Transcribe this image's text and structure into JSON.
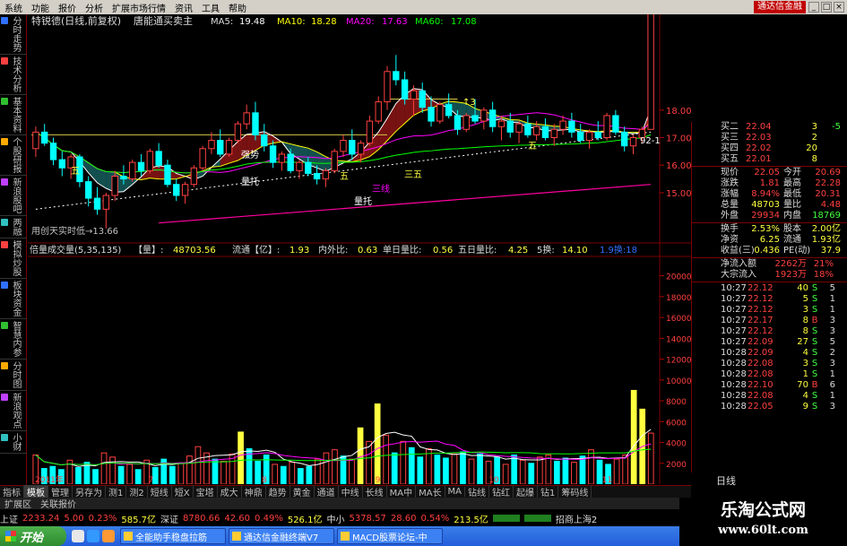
{
  "menubar": {
    "items": [
      "系统",
      "功能",
      "报价",
      "分析",
      "扩展市场行情",
      "资讯",
      "工具",
      "帮助"
    ],
    "brand": "通达信金融"
  },
  "left_tabs": [
    "分时走势",
    "技术分析",
    "基本资料",
    "个股研报",
    "新浪股吧",
    "两融",
    "模拟炒股",
    "板块资金",
    "智慧内参",
    "分时图",
    "新浪观点",
    "小财"
  ],
  "chart_header": {
    "stock": "特锐德(日线,前复权)",
    "tag": "唐能通买卖主",
    "ma5_label": "MA5:",
    "ma5": "19.48",
    "ma10_label": "MA10:",
    "ma10": "18.28",
    "ma20_label": "MA20:",
    "ma20": "17.63",
    "ma60_label": "MA60:",
    "ma60": "17.08"
  },
  "annotations": {
    "low_label": "用创天实时低→13.66",
    "qiangshi": "强势",
    "liangtuo1": "量托",
    "liangtuo2": "量托",
    "sanxian": "三线",
    "wu1": "五",
    "wu2": "五",
    "wu3": "五",
    "sanwu": "三五",
    "high_tag": "↑3",
    "ticker_tail": "92-1"
  },
  "price_axis": [
    "18.00",
    "17.00",
    "16.00",
    "15.00"
  ],
  "volume_header": {
    "name": "倍量成交量(5,35,135)",
    "vol_label": "【量】:",
    "vol": "48703.56",
    "flow_label": "流通【亿】:",
    "flow": "1.93",
    "inout_label": "内外比:",
    "inout": "0.63",
    "single_label": "单日量比:",
    "single": "0.56",
    "five_label": "五日量比:",
    "five": "4.25",
    "five_turn_label": "5换:",
    "five_turn": "14.10",
    "tail": "1.9换:18"
  },
  "volume_axis": [
    "20000",
    "18000",
    "16000",
    "14000",
    "12000",
    "10000",
    "8000",
    "6000",
    "4000",
    "2000"
  ],
  "x_axis": [
    "2011年",
    "7",
    "8",
    "9",
    "10",
    "11"
  ],
  "quote": {
    "asks": [
      {
        "label": "买二",
        "price": "22.04",
        "vol": "3",
        "chg": "-5"
      },
      {
        "label": "买三",
        "price": "22.03",
        "vol": "2",
        "chg": ""
      },
      {
        "label": "买四",
        "price": "22.02",
        "vol": "20",
        "chg": ""
      },
      {
        "label": "买五",
        "price": "22.01",
        "vol": "8",
        "chg": ""
      }
    ],
    "stats": [
      {
        "l1": "现价",
        "v1": "22.05",
        "l2": "今开",
        "v2": "20.69"
      },
      {
        "l1": "涨跌",
        "v1": "1.81",
        "l2": "最高",
        "v2": "22.28"
      },
      {
        "l1": "涨幅",
        "v1": "8.94%",
        "l2": "最低",
        "v2": "20.31"
      },
      {
        "l1": "总量",
        "v1": "48703",
        "l2": "量比",
        "v2": "4.48"
      },
      {
        "l1": "外盘",
        "v1": "29934",
        "l2": "内盘",
        "v2": "18769"
      }
    ],
    "stats2": [
      {
        "l1": "换手",
        "v1": "2.53%",
        "l2": "股本",
        "v2": "2.00亿"
      },
      {
        "l1": "净资",
        "v1": "6.25",
        "l2": "流通",
        "v2": "1.93亿"
      },
      {
        "l1": "收益(三)",
        "v1": "0.436",
        "l2": "PE(动)",
        "v2": "37.9"
      }
    ],
    "flows": [
      {
        "label": "净流入额",
        "value": "2262万",
        "pct": "21%"
      },
      {
        "label": "大宗流入",
        "value": "1923万",
        "pct": "18%"
      }
    ],
    "ticks": [
      {
        "time": "10:27",
        "price": "22.12",
        "vol": "40",
        "dir": "S",
        "n": "5"
      },
      {
        "time": "10:27",
        "price": "22.12",
        "vol": "5",
        "dir": "S",
        "n": "1"
      },
      {
        "time": "10:27",
        "price": "22.12",
        "vol": "3",
        "dir": "S",
        "n": "1"
      },
      {
        "time": "10:27",
        "price": "22.17",
        "vol": "8",
        "dir": "B",
        "n": "3"
      },
      {
        "time": "10:27",
        "price": "22.12",
        "vol": "8",
        "dir": "S",
        "n": "3"
      },
      {
        "time": "10:27",
        "price": "22.09",
        "vol": "27",
        "dir": "S",
        "n": "5"
      },
      {
        "time": "10:28",
        "price": "22.09",
        "vol": "4",
        "dir": "S",
        "n": "2"
      },
      {
        "time": "10:28",
        "price": "22.08",
        "vol": "3",
        "dir": "S",
        "n": "3"
      },
      {
        "time": "10:28",
        "price": "22.08",
        "vol": "1",
        "dir": "S",
        "n": "1"
      },
      {
        "time": "10:28",
        "price": "22.10",
        "vol": "70",
        "dir": "B",
        "n": "6"
      },
      {
        "time": "10:28",
        "price": "22.08",
        "vol": "4",
        "dir": "S",
        "n": "1"
      },
      {
        "time": "10:28",
        "price": "22.05",
        "vol": "9",
        "dir": "S",
        "n": "3"
      }
    ],
    "footer": "日线"
  },
  "indicator_tabs": [
    "指标",
    "模板",
    "管理",
    "另存为",
    "测1",
    "测2",
    "短线",
    "短X",
    "宝塔",
    "成大",
    "神鼎",
    "趋势",
    "黄金",
    "通道",
    "中线",
    "长线",
    "MA中",
    "MA长",
    "MA",
    "钻线",
    "钻红",
    "起爆",
    "钻1",
    "筹码线"
  ],
  "indicator_active": "模板",
  "sub_tabs": [
    "扩展区",
    "关联报价"
  ],
  "status": {
    "sh_label": "上证",
    "sh_val": "2233.24",
    "sh_chg": "5.00",
    "sh_pct": "0.23%",
    "sh_amt": "585.7亿",
    "sz_label": "深证",
    "sz_val": "8780.66",
    "sz_chg": "42.60",
    "sz_pct": "0.49%",
    "sz_amt": "526.1亿",
    "zx_label": "中小",
    "zx_val": "5378.57",
    "zx_chg": "28.60",
    "zx_pct": "0.54%",
    "zx_amt": "213.5亿",
    "broker": "招商上海2"
  },
  "taskbar": {
    "start": "开始",
    "tasks": [
      "全能助手稳盘拉筋",
      "通达信金融终端V7",
      "MACD股票论坛-中"
    ]
  },
  "watermark": {
    "line1": "乐淘公式网",
    "line2": "www.60lt.com"
  },
  "colors": {
    "up": "#ff4040",
    "down": "#00ffff",
    "ma5": "#ffffff",
    "ma10": "#ffff00",
    "ma20": "#ff00ff",
    "ma60": "#00ff00"
  },
  "chart_data": {
    "type": "candlestick",
    "candles": [
      [
        16.6,
        17.4,
        16.3,
        17.2
      ],
      [
        17.2,
        17.5,
        16.7,
        16.8
      ],
      [
        16.8,
        17.0,
        16.0,
        16.2
      ],
      [
        16.2,
        16.5,
        15.6,
        15.9
      ],
      [
        15.9,
        16.4,
        15.5,
        16.3
      ],
      [
        16.3,
        16.4,
        15.2,
        15.4
      ],
      [
        15.4,
        15.6,
        14.5,
        14.8
      ],
      [
        14.8,
        15.2,
        14.2,
        14.4
      ],
      [
        14.4,
        15.0,
        13.7,
        14.9
      ],
      [
        14.9,
        15.8,
        14.7,
        15.6
      ],
      [
        15.6,
        16.0,
        15.3,
        15.5
      ],
      [
        15.5,
        16.2,
        15.4,
        16.1
      ],
      [
        16.1,
        16.4,
        15.6,
        15.8
      ],
      [
        15.8,
        16.6,
        15.7,
        16.5
      ],
      [
        16.5,
        16.8,
        15.9,
        16.0
      ],
      [
        16.0,
        16.2,
        15.2,
        15.3
      ],
      [
        15.3,
        15.5,
        14.7,
        14.9
      ],
      [
        14.9,
        15.4,
        14.6,
        15.3
      ],
      [
        15.3,
        16.0,
        15.2,
        15.9
      ],
      [
        15.9,
        16.7,
        15.8,
        16.6
      ],
      [
        16.6,
        17.2,
        16.4,
        16.9
      ],
      [
        16.9,
        17.3,
        16.3,
        16.4
      ],
      [
        16.4,
        17.0,
        16.3,
        16.9
      ],
      [
        16.9,
        17.6,
        16.8,
        17.5
      ],
      [
        17.5,
        18.2,
        17.3,
        17.9
      ],
      [
        17.9,
        18.3,
        16.9,
        17.1
      ],
      [
        17.1,
        17.5,
        16.5,
        16.7
      ],
      [
        16.7,
        16.9,
        15.9,
        16.1
      ],
      [
        16.1,
        16.5,
        15.8,
        16.4
      ],
      [
        16.4,
        16.6,
        15.7,
        15.8
      ],
      [
        15.8,
        16.2,
        15.5,
        16.1
      ],
      [
        16.1,
        16.3,
        15.6,
        15.7
      ],
      [
        15.7,
        16.0,
        15.3,
        15.5
      ],
      [
        15.5,
        15.9,
        15.2,
        15.8
      ],
      [
        15.8,
        16.6,
        15.7,
        16.5
      ],
      [
        16.5,
        17.1,
        16.3,
        16.9
      ],
      [
        16.9,
        17.3,
        16.2,
        16.4
      ],
      [
        16.4,
        16.9,
        16.1,
        16.8
      ],
      [
        16.8,
        17.8,
        16.7,
        17.6
      ],
      [
        17.6,
        18.5,
        17.5,
        18.3
      ],
      [
        18.3,
        19.6,
        18.0,
        19.4
      ],
      [
        19.4,
        20.0,
        18.9,
        19.1
      ],
      [
        19.1,
        19.4,
        18.2,
        18.4
      ],
      [
        18.4,
        18.9,
        17.8,
        18.7
      ],
      [
        18.7,
        19.0,
        17.9,
        18.1
      ],
      [
        18.1,
        18.5,
        17.4,
        17.6
      ],
      [
        17.6,
        18.3,
        17.5,
        18.2
      ],
      [
        18.2,
        18.6,
        17.7,
        17.8
      ],
      [
        17.8,
        18.0,
        17.1,
        17.3
      ],
      [
        17.3,
        17.9,
        17.2,
        17.8
      ],
      [
        17.8,
        18.4,
        17.5,
        17.6
      ],
      [
        17.6,
        18.1,
        17.3,
        18.0
      ],
      [
        18.0,
        18.3,
        17.2,
        17.4
      ],
      [
        17.4,
        17.8,
        16.9,
        17.6
      ],
      [
        17.6,
        17.9,
        17.0,
        17.2
      ],
      [
        17.2,
        17.6,
        16.8,
        17.5
      ],
      [
        17.5,
        17.8,
        17.0,
        17.1
      ],
      [
        17.1,
        17.6,
        16.9,
        17.4
      ],
      [
        17.4,
        17.7,
        16.9,
        17.0
      ],
      [
        17.0,
        17.5,
        16.7,
        17.3
      ],
      [
        17.3,
        17.8,
        17.1,
        17.6
      ],
      [
        17.6,
        17.9,
        17.0,
        17.2
      ],
      [
        17.2,
        17.5,
        16.8,
        16.9
      ],
      [
        16.9,
        17.3,
        16.6,
        17.2
      ],
      [
        17.2,
        17.6,
        16.9,
        17.0
      ],
      [
        17.0,
        17.9,
        16.9,
        17.8
      ],
      [
        17.8,
        18.0,
        17.1,
        17.2
      ],
      [
        17.2,
        17.4,
        16.5,
        16.7
      ],
      [
        16.7,
        17.1,
        16.4,
        17.0
      ],
      [
        17.0,
        17.4,
        16.8,
        17.3
      ],
      [
        17.3,
        22.3,
        20.3,
        22.05
      ]
    ],
    "volumes": [
      [
        2800,
        1
      ],
      [
        1500,
        0
      ],
      [
        1700,
        0
      ],
      [
        1400,
        0
      ],
      [
        2300,
        1
      ],
      [
        1600,
        0
      ],
      [
        2100,
        0
      ],
      [
        1400,
        0
      ],
      [
        3000,
        1
      ],
      [
        2600,
        1
      ],
      [
        1700,
        0
      ],
      [
        1900,
        1
      ],
      [
        1400,
        0
      ],
      [
        2300,
        1
      ],
      [
        1600,
        0
      ],
      [
        2400,
        0
      ],
      [
        1700,
        0
      ],
      [
        2000,
        1
      ],
      [
        2700,
        1
      ],
      [
        3600,
        1
      ],
      [
        3000,
        1
      ],
      [
        2400,
        0
      ],
      [
        2200,
        1
      ],
      [
        2900,
        1
      ],
      [
        5000,
        2
      ],
      [
        3400,
        0
      ],
      [
        2200,
        0
      ],
      [
        2800,
        0
      ],
      [
        1900,
        1
      ],
      [
        1700,
        0
      ],
      [
        2100,
        1
      ],
      [
        1500,
        0
      ],
      [
        1700,
        0
      ],
      [
        2400,
        1
      ],
      [
        3000,
        1
      ],
      [
        3300,
        1
      ],
      [
        2700,
        0
      ],
      [
        2400,
        1
      ],
      [
        5400,
        2
      ],
      [
        4100,
        1
      ],
      [
        7700,
        2
      ],
      [
        4700,
        1
      ],
      [
        3000,
        0
      ],
      [
        4100,
        1
      ],
      [
        3500,
        0
      ],
      [
        2600,
        0
      ],
      [
        3400,
        1
      ],
      [
        2800,
        0
      ],
      [
        2500,
        0
      ],
      [
        2900,
        1
      ],
      [
        3100,
        0
      ],
      [
        2400,
        1
      ],
      [
        2900,
        0
      ],
      [
        2200,
        1
      ],
      [
        2600,
        0
      ],
      [
        1900,
        1
      ],
      [
        2800,
        0
      ],
      [
        2300,
        1
      ],
      [
        2000,
        0
      ],
      [
        2600,
        1
      ],
      [
        2800,
        1
      ],
      [
        2200,
        0
      ],
      [
        2500,
        0
      ],
      [
        2100,
        1
      ],
      [
        2700,
        0
      ],
      [
        3300,
        1
      ],
      [
        2300,
        0
      ],
      [
        1900,
        0
      ],
      [
        2400,
        1
      ],
      [
        2800,
        1
      ],
      [
        9000,
        2
      ],
      [
        7200,
        2
      ],
      [
        4900,
        1
      ]
    ],
    "price_ylim": [
      13.5,
      20.5
    ],
    "volume_ylim": [
      0,
      21000
    ],
    "volume_color_key": {
      "0": "down",
      "1": "up",
      "2": "double"
    }
  }
}
